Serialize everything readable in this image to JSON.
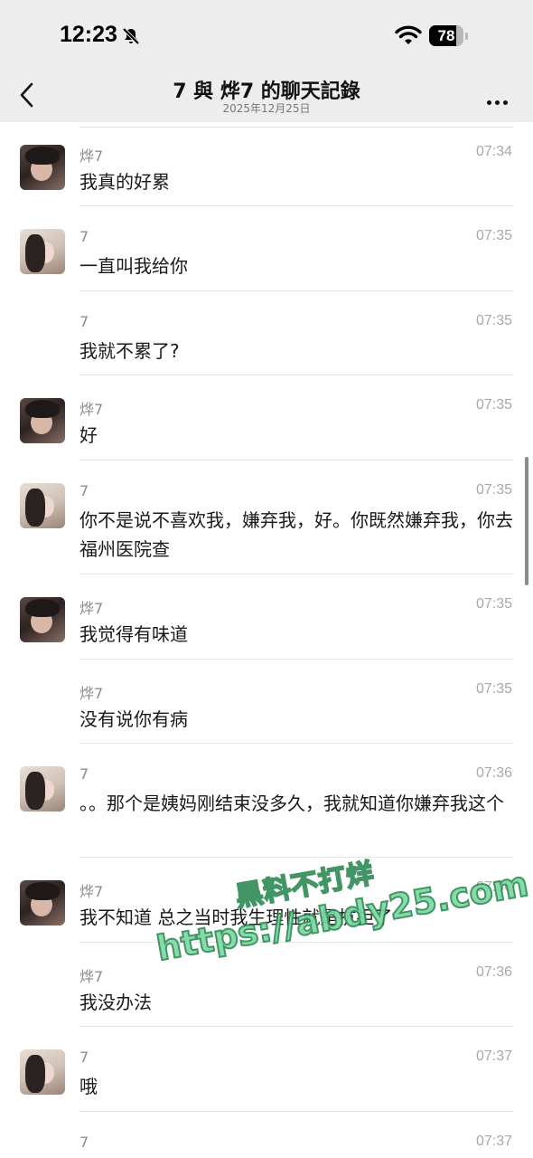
{
  "status_bar": {
    "time": "12:23",
    "battery_level": "78"
  },
  "nav": {
    "title": "7 與 烨7 的聊天記錄",
    "date": "2025年12月25日"
  },
  "messages": [
    {
      "sender": "烨7",
      "time": "07:34",
      "text": "我真的好累",
      "avatar": "male",
      "show_avatar": true
    },
    {
      "sender": "7",
      "time": "07:35",
      "text": "一直叫我给你",
      "avatar": "female",
      "show_avatar": true
    },
    {
      "sender": "7",
      "time": "07:35",
      "text": "我就不累了?",
      "avatar": "female",
      "show_avatar": false
    },
    {
      "sender": "烨7",
      "time": "07:35",
      "text": "好",
      "avatar": "male",
      "show_avatar": true
    },
    {
      "sender": "7",
      "time": "07:35",
      "text": "你不是说不喜欢我，嫌弃我，好。你既然嫌弃我，你去福州医院查",
      "avatar": "female",
      "show_avatar": true
    },
    {
      "sender": "烨7",
      "time": "07:35",
      "text": "我觉得有味道",
      "avatar": "male",
      "show_avatar": true
    },
    {
      "sender": "烨7",
      "time": "07:35",
      "text": "没有说你有病",
      "avatar": "male",
      "show_avatar": false
    },
    {
      "sender": "7",
      "time": "07:36",
      "text": "。。那个是姨妈刚结束没多久，我就知道你嫌弃我这个",
      "avatar": "female",
      "show_avatar": true
    },
    {
      "sender": "烨7",
      "time": "07:36",
      "text": "我不知道 总之当时我生理性就是抗拒了",
      "avatar": "male",
      "show_avatar": true
    },
    {
      "sender": "烨7",
      "time": "07:36",
      "text": "我没办法",
      "avatar": "male",
      "show_avatar": false
    },
    {
      "sender": "7",
      "time": "07:37",
      "text": "哦",
      "avatar": "female",
      "show_avatar": true
    },
    {
      "sender": "7",
      "time": "07:37",
      "text": "",
      "avatar": "female",
      "show_avatar": false
    }
  ],
  "watermark": {
    "line1": "黑料不打烊",
    "line2": "https://abdy25.com"
  }
}
